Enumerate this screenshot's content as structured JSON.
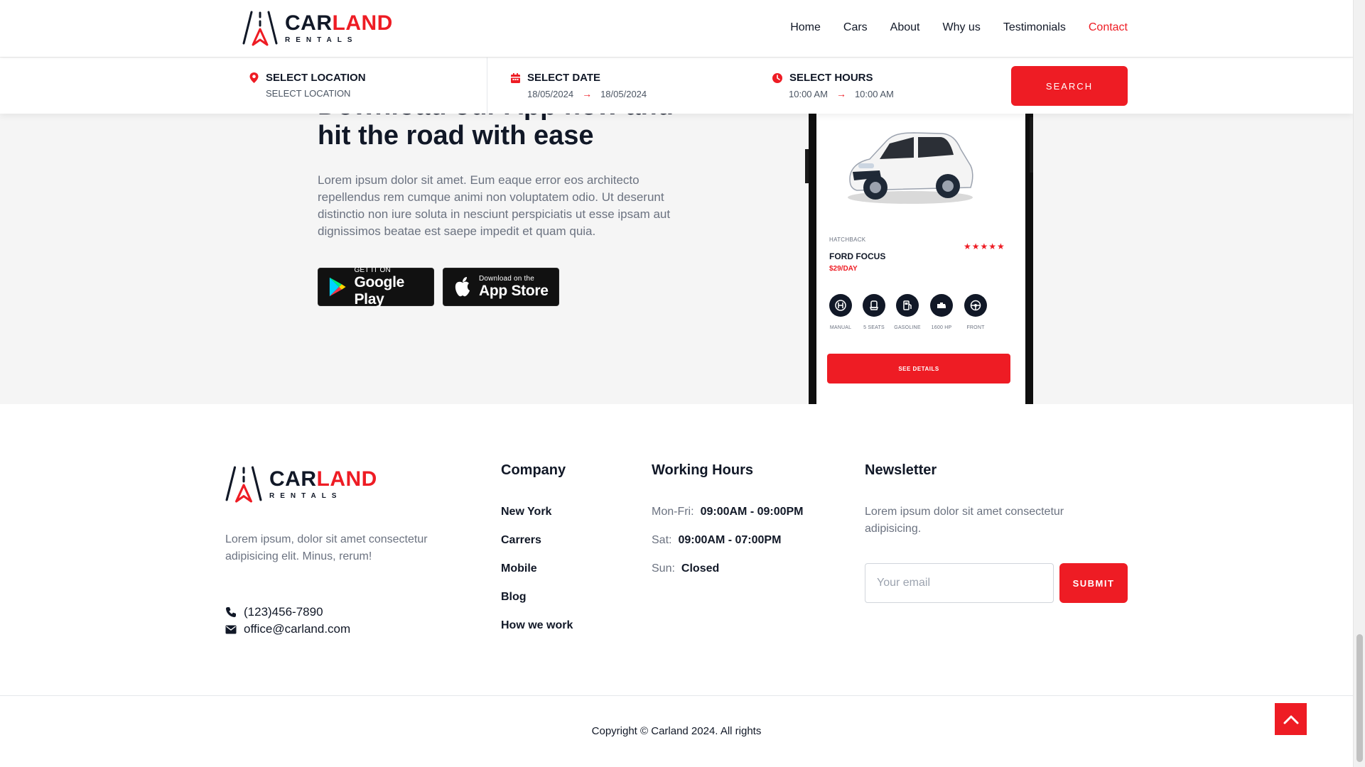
{
  "brand": {
    "name_part1": "CAR",
    "name_part2": "LAND",
    "subtitle": "RENTALS",
    "accent_color": "#ee1c24"
  },
  "nav": {
    "links": [
      "Home",
      "Cars",
      "About",
      "Why us",
      "Testimonials",
      "Contact"
    ],
    "active": "Contact"
  },
  "booking": {
    "location": {
      "icon": "map-pin-icon",
      "title": "SELECT LOCATION",
      "value": "SELECT LOCATION"
    },
    "date": {
      "icon": "calendar-icon",
      "title": "SELECT DATE",
      "from": "18/05/2024",
      "to": "18/05/2024"
    },
    "hours": {
      "icon": "clock-icon",
      "title": "SELECT HOURS",
      "from": "10:00 AM",
      "to": "10:00 AM"
    },
    "arrow_glyph": "→",
    "search_label": "SEARCH"
  },
  "app_promo": {
    "heading_line1": "Download our App now and",
    "heading_line2": "hit the road with ease",
    "description": "Lorem ipsum dolor sit amet. Eum eaque error eos architecto repellendus rem cumque animi non voluptatem odio. Ut deserunt distinctio non iure soluta in nesciunt perspiciatis ut esse ipsam aut dignissimos beatae est saepe impedit et quam quia.",
    "google_play": {
      "small": "GET IT ON",
      "big": "Google Play"
    },
    "app_store": {
      "small": "Download on the",
      "big": "App Store"
    }
  },
  "phone_card": {
    "category": "HATCHBACK",
    "stars": "★★★★★",
    "rating": 5,
    "car_name": "FORD FOCUS",
    "price": "$29/DAY",
    "specs": [
      {
        "icon": "gearbox-icon",
        "label": "MANUAL"
      },
      {
        "icon": "seat-icon",
        "label": "5 SEATS"
      },
      {
        "icon": "fuel-pump-icon",
        "label": "GASOLINE"
      },
      {
        "icon": "engine-icon",
        "label": "1600 HP"
      },
      {
        "icon": "steering-wheel-icon",
        "label": "FRONT"
      }
    ],
    "cta": "SEE DETAILS"
  },
  "footer": {
    "about": "Lorem ipsum, dolor sit amet consectetur adipisicing elit. Minus, rerum!",
    "phone": "(123)456-7890",
    "email": "office@carland.com",
    "company": {
      "title": "Company",
      "links": [
        "New York",
        "Carrers",
        "Mobile",
        "Blog",
        "How we work"
      ]
    },
    "hours": {
      "title": "Working Hours",
      "rows": [
        {
          "day": "Mon-Fri:",
          "time": "09:00AM - 09:00PM"
        },
        {
          "day": "Sat:",
          "time": "09:00AM - 07:00PM"
        },
        {
          "day": "Sun:",
          "time": "Closed"
        }
      ]
    },
    "newsletter": {
      "title": "Newsletter",
      "description": "Lorem ipsum dolor sit amet consectetur adipisicing.",
      "placeholder": "Your email",
      "submit": "SUBMIT"
    },
    "copyright": "Copyright © Carland 2024. All rights"
  }
}
